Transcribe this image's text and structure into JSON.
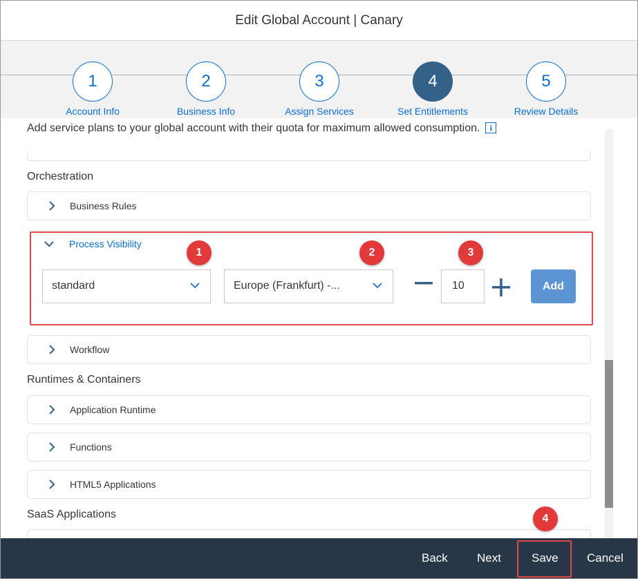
{
  "dialog": {
    "title": "Edit Global Account | Canary"
  },
  "wizard": {
    "steps": [
      {
        "number": "1",
        "label": "Account Info"
      },
      {
        "number": "2",
        "label": "Business Info"
      },
      {
        "number": "3",
        "label": "Assign Services"
      },
      {
        "number": "4",
        "label": "Set Entitlements",
        "active": true
      },
      {
        "number": "5",
        "label": "Review Details"
      }
    ]
  },
  "intro": "Add service plans to your global account with their quota for maximum allowed consumption.",
  "info_icon": "i",
  "sections": {
    "orchestration": "Orchestration",
    "runtimes": "Runtimes & Containers",
    "saas": "SaaS Applications"
  },
  "panels": {
    "business_rules": "Business Rules",
    "process_visibility": "Process Visibility",
    "workflow": "Workflow",
    "application_runtime": "Application Runtime",
    "functions": "Functions",
    "html5": "HTML5 Applications"
  },
  "entitlement_form": {
    "plan_value": "standard",
    "region_value": "Europe (Frankfurt) -...",
    "quantity": "10",
    "minus": "−",
    "plus": "+",
    "add_label": "Add"
  },
  "badges": {
    "b1": "1",
    "b2": "2",
    "b3": "3",
    "b4": "4"
  },
  "footer": {
    "back": "Back",
    "next": "Next",
    "save": "Save",
    "cancel": "Cancel"
  },
  "colors": {
    "accent": "#0a6ed1",
    "active_step": "#346187",
    "highlight": "#e2474b",
    "footer_bg": "#283747",
    "add_button": "#5c95d1"
  },
  "icons": [
    "chevron-right-icon",
    "chevron-down-icon",
    "info-icon"
  ]
}
